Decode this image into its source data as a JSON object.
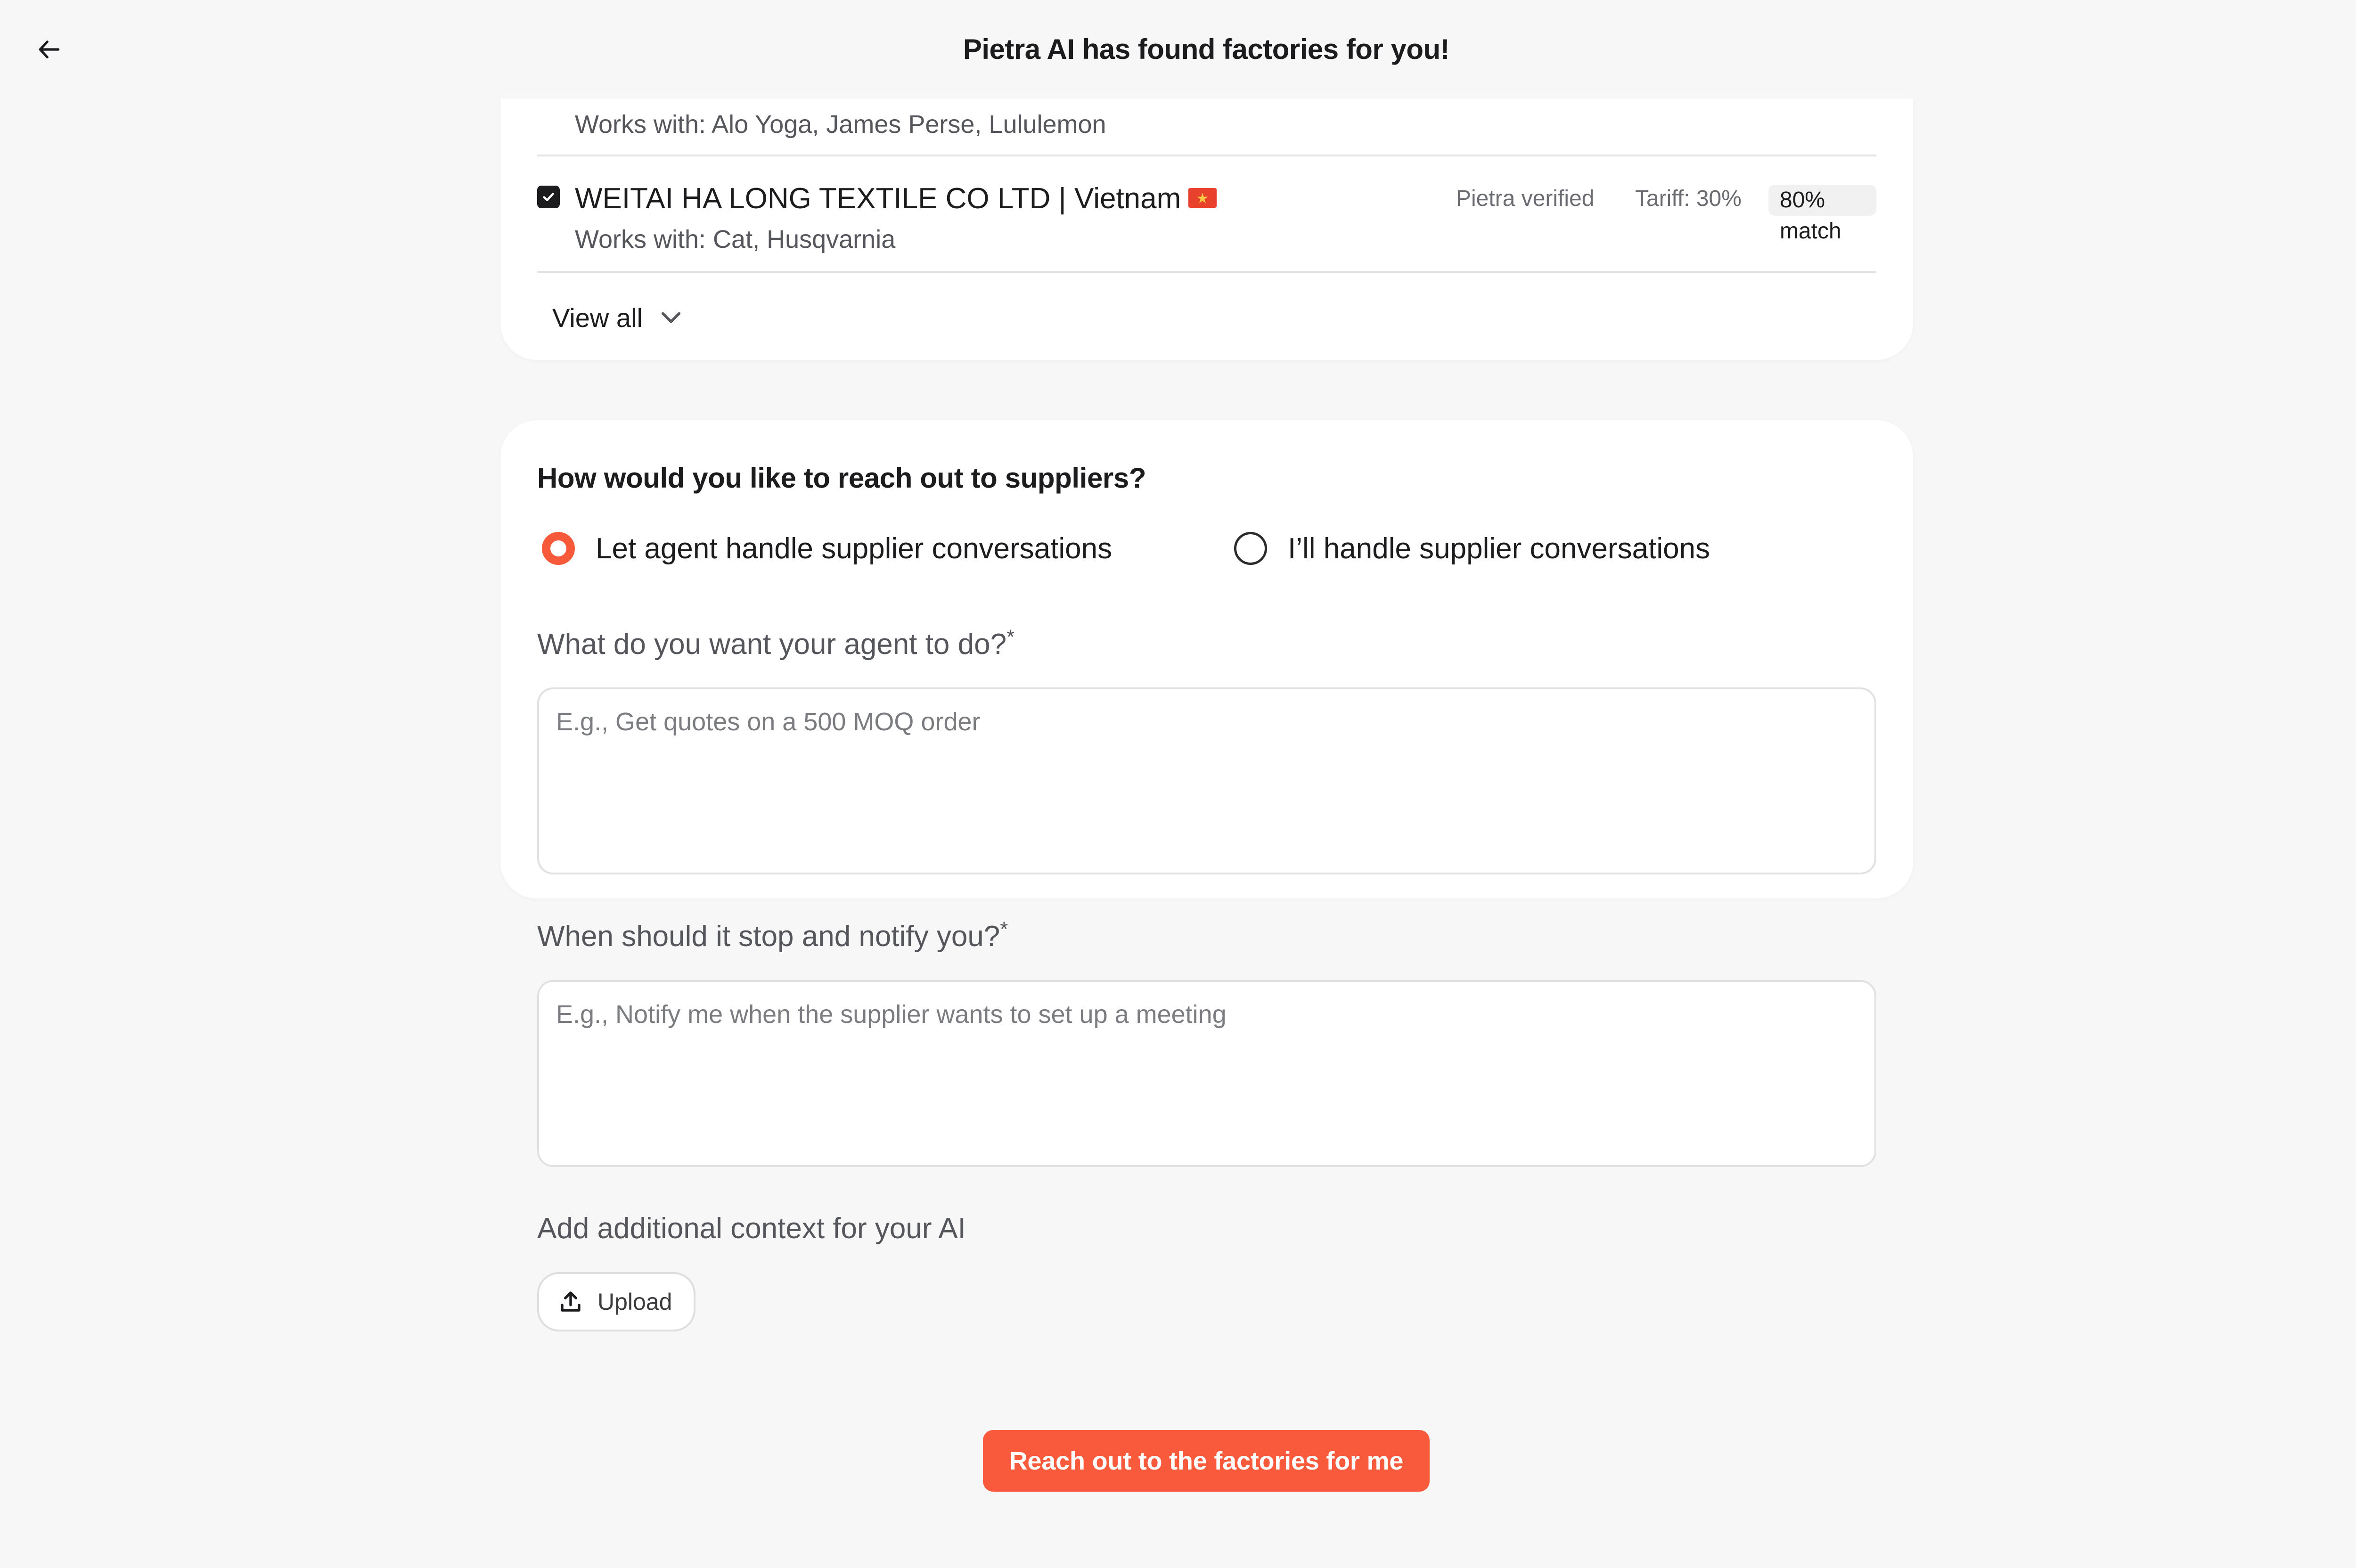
{
  "header": {
    "title": "Pietra AI has found factories for you!",
    "back_icon": "arrow-left-icon"
  },
  "factories": {
    "prev_works_with": "Works with: Alo Yoga, James Perse, Lululemon",
    "items": [
      {
        "name": "WEITAI HA LONG TEXTILE CO LTD | Vietnam",
        "flag": "vietnam-flag-icon",
        "checked": true,
        "verified": "Pietra verified",
        "tariff": "Tariff: 30%",
        "match": "80% match",
        "works_with": "Works with: Cat, Husqvarnia"
      }
    ],
    "view_all_label": "View all"
  },
  "outreach": {
    "question": "How would you like to reach out to suppliers?",
    "options": [
      {
        "label": "Let agent handle supplier conversations",
        "selected": true
      },
      {
        "label": "I’ll handle supplier conversations",
        "selected": false
      }
    ],
    "agent_task": {
      "label": "What do you want your agent to do?",
      "required_mark": "*",
      "value": "",
      "placeholder": "E.g., Get quotes on a 500 MOQ order"
    },
    "stop_condition": {
      "label": "When should it stop and notify you?",
      "required_mark": "*",
      "value": "",
      "placeholder": "E.g., Notify me when the supplier wants to set up a meeting"
    },
    "context": {
      "label": "Add additional context for your AI",
      "upload_label": "Upload"
    }
  },
  "cta": {
    "label": "Reach out to the factories for me"
  },
  "colors": {
    "accent": "#fa5a3c",
    "background": "#f7f7f8",
    "card": "#ffffff"
  }
}
